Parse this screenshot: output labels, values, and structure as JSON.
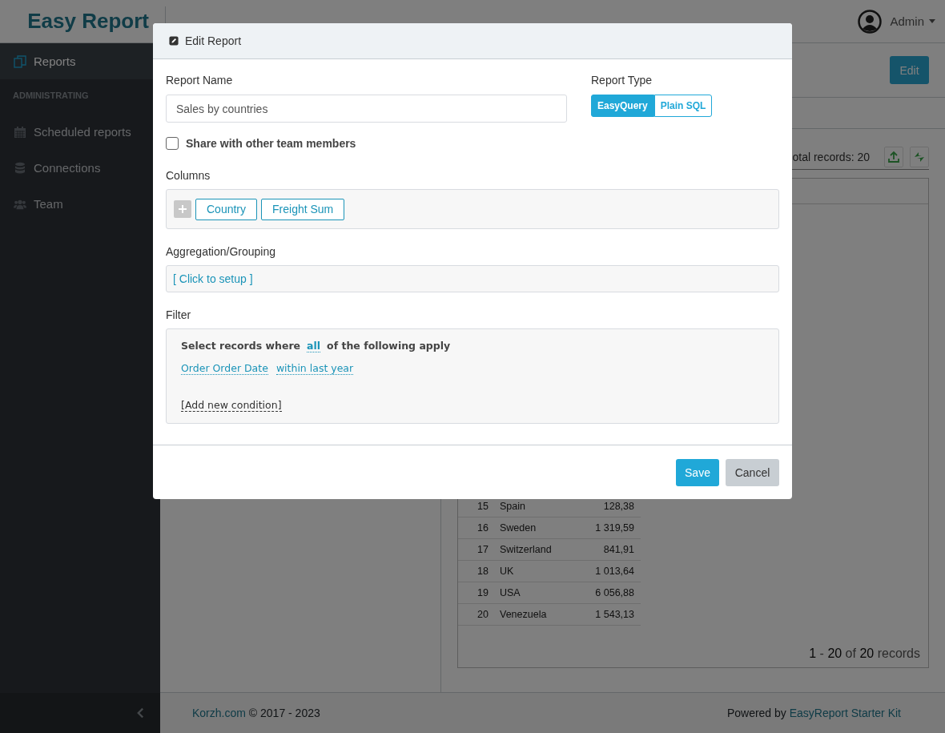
{
  "header": {
    "logo": "Easy Report",
    "user": "Admin"
  },
  "sidebar": {
    "items": [
      {
        "kind": "link",
        "label": "Reports",
        "selected": true
      },
      {
        "kind": "section",
        "label": "ADMINISTRATING"
      },
      {
        "kind": "link",
        "label": "Scheduled reports",
        "selected": false
      },
      {
        "kind": "link",
        "label": "Connections",
        "selected": false
      },
      {
        "kind": "link",
        "label": "Team",
        "selected": false
      }
    ]
  },
  "toolbar": {
    "edit_button": "Edit"
  },
  "results": {
    "total": "otal records: 20",
    "rows": [
      {
        "n": "15",
        "country": "Spain",
        "value": "128,38"
      },
      {
        "n": "16",
        "country": "Sweden",
        "value": "1 319,59"
      },
      {
        "n": "17",
        "country": "Switzerland",
        "value": "841,91"
      },
      {
        "n": "18",
        "country": "UK",
        "value": "1 013,64"
      },
      {
        "n": "19",
        "country": "USA",
        "value": "6 056,88"
      },
      {
        "n": "20",
        "country": "Venezuela",
        "value": "1 543,13"
      }
    ],
    "pager": "**1** - **20** of **20** records"
  },
  "footer": {
    "link": "Korzh.com",
    "copyright": "© 2017 - 2023",
    "powered_by": "Powered by",
    "kit_link": "EasyReport Starter Kit"
  },
  "modal": {
    "title": "Edit Report",
    "report_name": {
      "label": "Report Name",
      "value": "Sales by countries"
    },
    "report_type": {
      "label": "Report Type",
      "options": [
        {
          "label": "EasyQuery",
          "selected": true
        },
        {
          "label": "Plain SQL",
          "selected": false
        }
      ]
    },
    "share": {
      "label": "Share with other team members",
      "checked": false
    },
    "columns": {
      "label": "Columns",
      "items": [
        "Country",
        "Freight Sum"
      ]
    },
    "aggregation": {
      "label": "Aggregation/Grouping",
      "link": "[ Click to setup ]"
    },
    "filter": {
      "label": "Filter",
      "intro_before": "Select records where",
      "mode": "all",
      "intro_after": "of the following apply",
      "conditions": [
        {
          "field": "Order Order Date",
          "operator": "within last year"
        }
      ],
      "add": "[Add new condition]"
    },
    "buttons": {
      "save": "Save",
      "cancel": "Cancel"
    }
  }
}
